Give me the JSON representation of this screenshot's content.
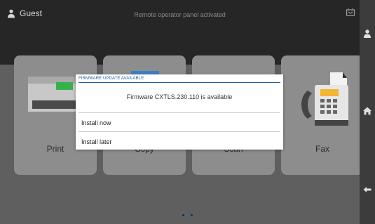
{
  "header": {
    "user_label": "Guest",
    "status_text": "Remote operator panel activated",
    "user_icon": "person-icon",
    "tray_icon": "inbox-tray-icon"
  },
  "tiles": [
    {
      "label": "Print",
      "icon": "printer-icon"
    },
    {
      "label": "Copy",
      "icon": "copier-icon"
    },
    {
      "label": "Scan",
      "icon": "scanner-icon"
    },
    {
      "label": "Fax",
      "icon": "fax-icon"
    }
  ],
  "pager": {
    "page": 2,
    "total": 3
  },
  "sidebar": {
    "icons": [
      "person-icon",
      "home-icon",
      "back-arrow-icon"
    ]
  },
  "dialog": {
    "title": "FIRMWARE UPDATE AVAILABLE",
    "message": "Firmware CXTLS.230.110 is available",
    "options": [
      "Install now",
      "Install later"
    ]
  },
  "colors": {
    "accent": "#1f5fa8",
    "page_dot_active": "#2a73b8"
  }
}
